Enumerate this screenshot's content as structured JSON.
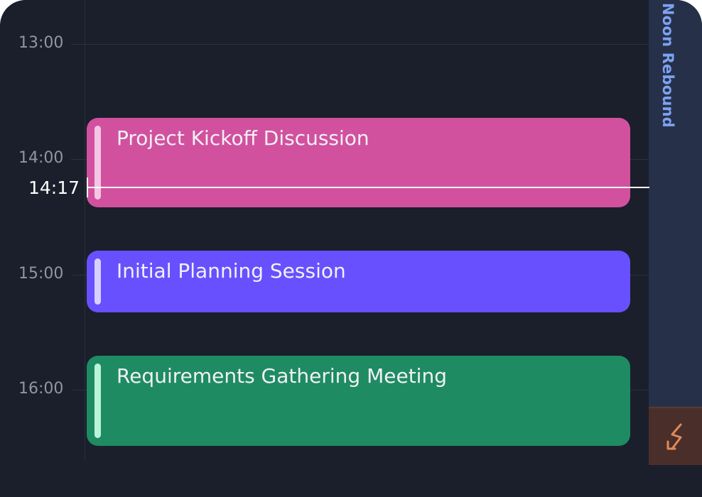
{
  "timeline": {
    "hours": [
      "13:00",
      "14:00",
      "15:00",
      "16:00"
    ],
    "current_time": "14:17"
  },
  "events": [
    {
      "title": "Project Kickoff Discussion",
      "color": "#d2519f",
      "bar_color": "#f3c6e4"
    },
    {
      "title": "Initial Planning Session",
      "color": "#6850ff",
      "bar_color": "#d7d0ff"
    },
    {
      "title": "Requirements Gathering Meeting",
      "color": "#1e8b63",
      "bar_color": "#b9f4d8"
    }
  ],
  "side_panel": {
    "title": "Noon Rebound",
    "badge_icon": "zigzag-arrow-icon",
    "accent": "#7ea2f2",
    "badge_color": "#e08a5a"
  }
}
